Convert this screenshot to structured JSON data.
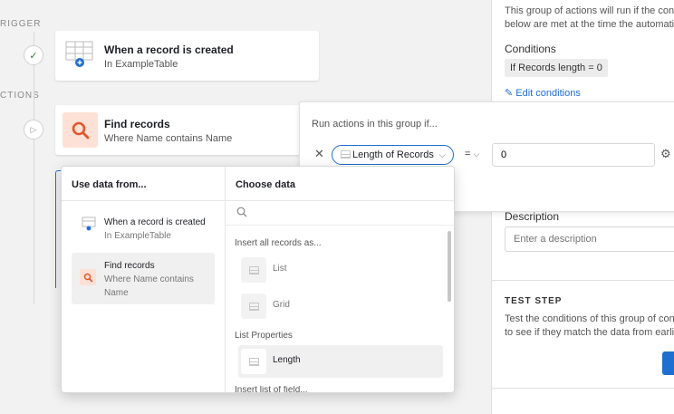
{
  "canvas": {
    "trigger_label": "RIGGER",
    "actions_label": "CTIONS",
    "trigger_card": {
      "title": "When a record is created",
      "subtitle": "In ExampleTable"
    },
    "find_card": {
      "title": "Find records",
      "subtitle": "Where Name contains Name"
    }
  },
  "right_panel": {
    "intro_line1": "This group of actions will run if the cond",
    "intro_line2": "below are met at the time the automati",
    "conditions_heading": "Conditions",
    "condition_pill": "If Records length = 0",
    "edit_conditions": "Edit conditions",
    "description_label": "Description",
    "description_placeholder": "Enter a description",
    "test_step_heading": "TEST STEP",
    "test_text_line1": "Test the conditions of this group of con",
    "test_text_line2": "to see if they match the data from earli"
  },
  "condition_editor": {
    "heading": "Run actions in this group if...",
    "field_pill": "Length of Records",
    "operator": "=",
    "value": "0"
  },
  "popover": {
    "left_heading": "Use data from...",
    "sources": [
      {
        "title": "When a record is created",
        "subtitle": "In ExampleTable"
      },
      {
        "title": "Find records",
        "subtitle_line1": "Where Name contains",
        "subtitle_line2": "Name"
      }
    ],
    "right_heading": "Choose data",
    "search_placeholder": "",
    "insert_section": "Insert all records as...",
    "insert_options": [
      "List",
      "Grid"
    ],
    "list_properties_section": "List Properties",
    "list_properties": [
      "Length"
    ],
    "truncated_section": "Insert list of field..."
  },
  "colors": {
    "accent": "#1f6fd0",
    "find_icon_bg": "#fde1d6",
    "find_icon_fg": "#e0572d",
    "check_green": "#2d7f3f"
  }
}
